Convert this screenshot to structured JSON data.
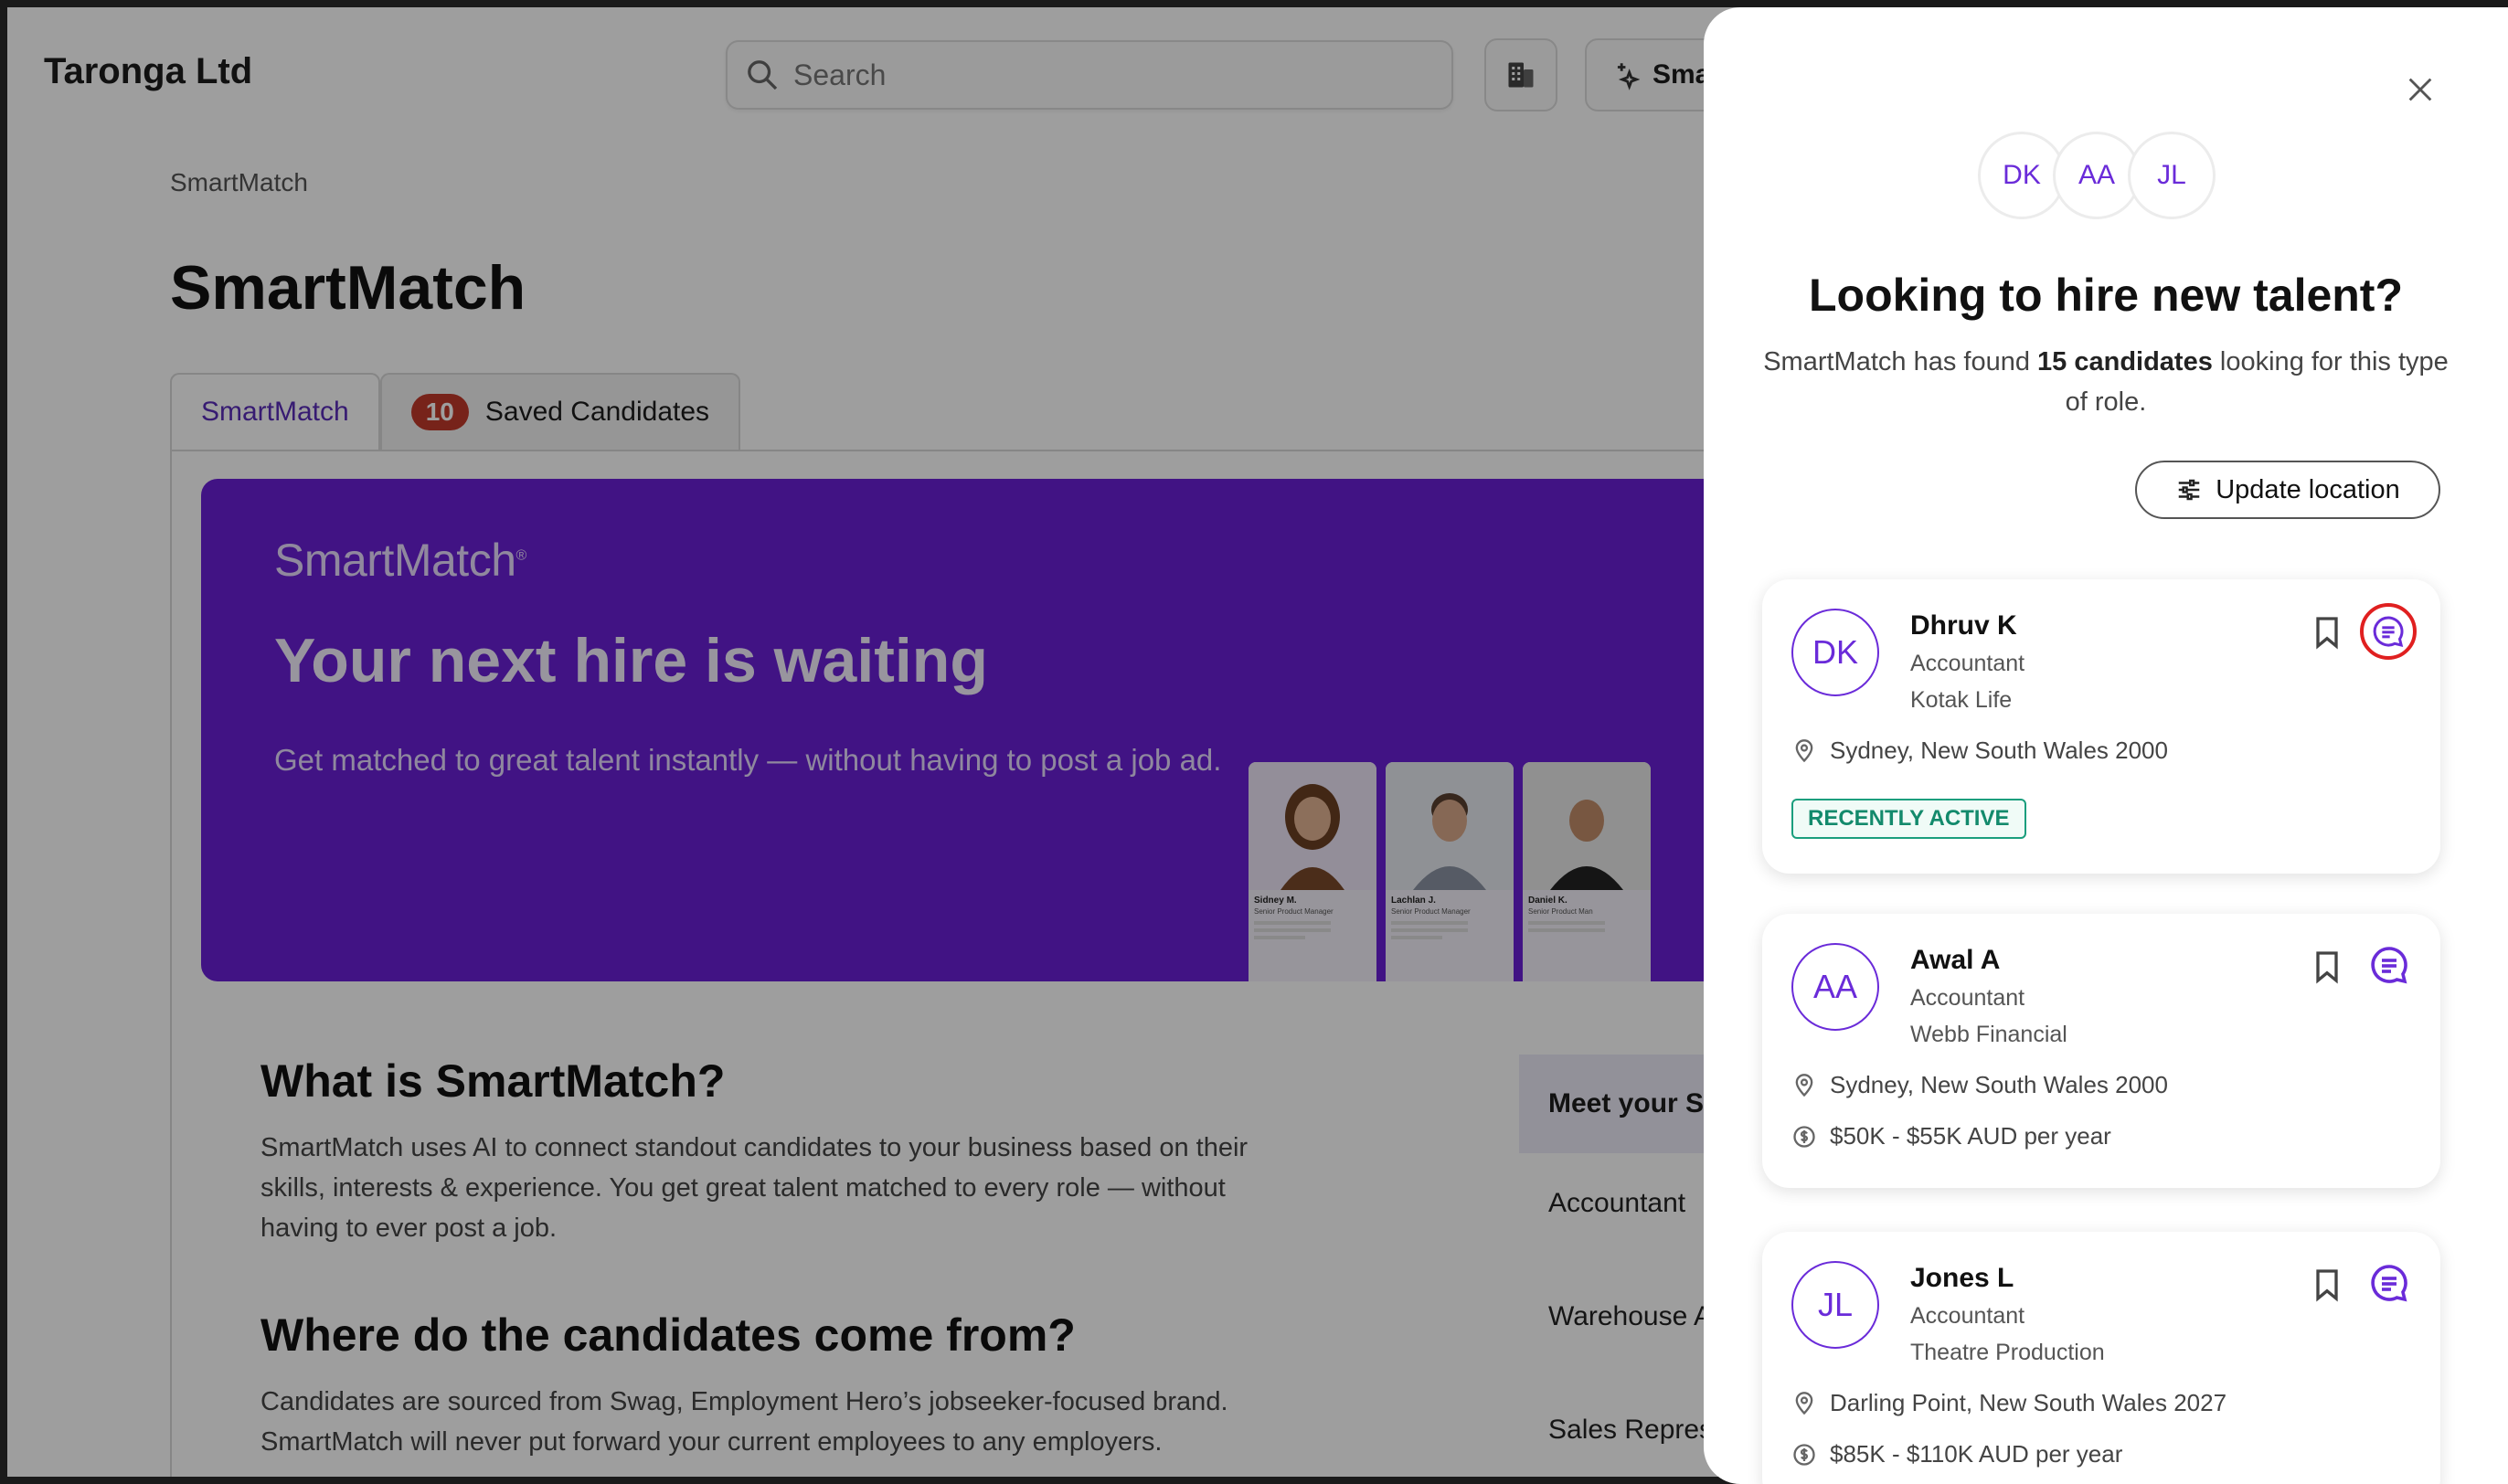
{
  "app": {
    "company": "Taronga Ltd"
  },
  "header": {
    "search_placeholder": "Search",
    "smartmatch_button": "Sma"
  },
  "breadcrumb": "SmartMatch",
  "page_title": "SmartMatch",
  "tabs": [
    {
      "label": "SmartMatch"
    },
    {
      "count": "10",
      "label": "Saved Candidates"
    }
  ],
  "hero": {
    "logo": "SmartMatch",
    "tagline": "Your next hire is waiting",
    "description": "Get matched to great talent instantly — without having to post a job ad.",
    "cards": [
      {
        "name": "Sidney M.",
        "role": "Senior Product Manager"
      },
      {
        "name": "Lachlan J.",
        "role": "Senior Product Manager"
      },
      {
        "name": "Daniel K.",
        "role": "Senior Product Man"
      }
    ]
  },
  "sections": [
    {
      "heading": "What is SmartMatch?",
      "body": "SmartMatch uses AI to connect standout candidates to your business based on their skills, interests & experience. You get great talent matched to every role — without having to ever post a job."
    },
    {
      "heading": "Where do the candidates come from?",
      "body": "Candidates are sourced from Swag, Employment Hero’s jobseeker-focused brand. SmartMatch will never put forward your current employees to any employers."
    }
  ],
  "side_list": {
    "title": "Meet your Sm",
    "roles": [
      "Accountant",
      "Warehouse A",
      "Sales Represe"
    ]
  },
  "drawer": {
    "avatars": [
      "DK",
      "AA",
      "JL"
    ],
    "title": "Looking to hire new talent?",
    "subtitle_pre": "SmartMatch has found ",
    "subtitle_bold": "15 candidates",
    "subtitle_post": " looking for this type of role.",
    "update_location": "Update location",
    "candidates": [
      {
        "initials": "DK",
        "name": "Dhruv K",
        "role": "Accountant",
        "company": "Kotak Life",
        "location": "Sydney, New South Wales 2000",
        "badge": "RECENTLY ACTIVE"
      },
      {
        "initials": "AA",
        "name": "Awal A",
        "role": "Accountant",
        "company": "Webb Financial",
        "location": "Sydney, New South Wales 2000",
        "salary": "$50K - $55K AUD per year"
      },
      {
        "initials": "JL",
        "name": "Jones L",
        "role": "Accountant",
        "company": "Theatre Production",
        "location": "Darling Point, New South Wales 2027",
        "salary": "$85K - $110K AUD per year"
      }
    ]
  },
  "colors": {
    "brand_purple": "#6a1fd6",
    "accent_text": "#6a2bd9",
    "badge_green": "#1a9e7d",
    "count_red": "#c0392b",
    "highlight_red": "#e02020"
  }
}
